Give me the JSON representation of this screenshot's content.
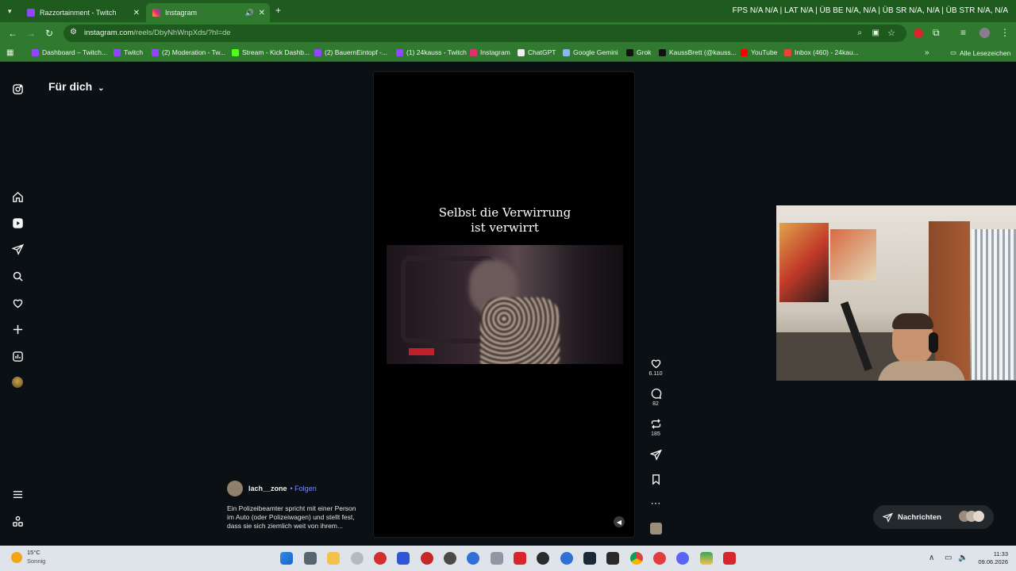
{
  "browser": {
    "tabs": [
      {
        "label": "Razzortainment - Twitch",
        "active": false
      },
      {
        "label": "Instagram",
        "active": true
      }
    ],
    "stats": "FPS N/A N/A | LAT N/A | ÜB BE N/A, N/A | ÜB SR N/A, N/A | ÜB STR N/A, N/A",
    "url_host": "instagram.com",
    "url_path": "/reels/DbyNhWnpXds/?hl=de",
    "bookmarks": [
      "Dashboard – Twitch...",
      "Twitch",
      "(2) Moderation - Tw...",
      "Stream - Kick Dashb...",
      "(2) BauernEintopf -...",
      "(1) 24kauss - Twitch",
      "Instagram",
      "ChatGPT",
      "Google Gemini",
      "Grok",
      "KaussBrett (@kauss...",
      "YouTube",
      "Inbox (460) - 24kau..."
    ],
    "all_bookmarks": "Alle Lesezeichen"
  },
  "instagram": {
    "feed_title": "Für dich",
    "reel": {
      "caption_line1": "Selbst die Verwirrung",
      "caption_line2": "ist verwirrt",
      "author": "lach__zone",
      "follow": "• Folgen",
      "description": "Ein Polizeibeamter spricht mit einer Person im Auto (oder Polizeiwagen) und stellt fest, dass sie sich ziemlich weit von ihrem..."
    },
    "actions": {
      "likes": "6.110",
      "comments": "82",
      "reposts": "185"
    },
    "messages_label": "Nachrichten"
  },
  "taskbar": {
    "temperature": "15°C",
    "weather": "Sonnig",
    "time": "11:33",
    "date": "09.06.2026"
  },
  "colors": {
    "tab_strip": "#1f5b1f",
    "toolbar": "#2f7a2f",
    "page_bg": "#0b1014",
    "follow_link": "#7b8cff"
  }
}
